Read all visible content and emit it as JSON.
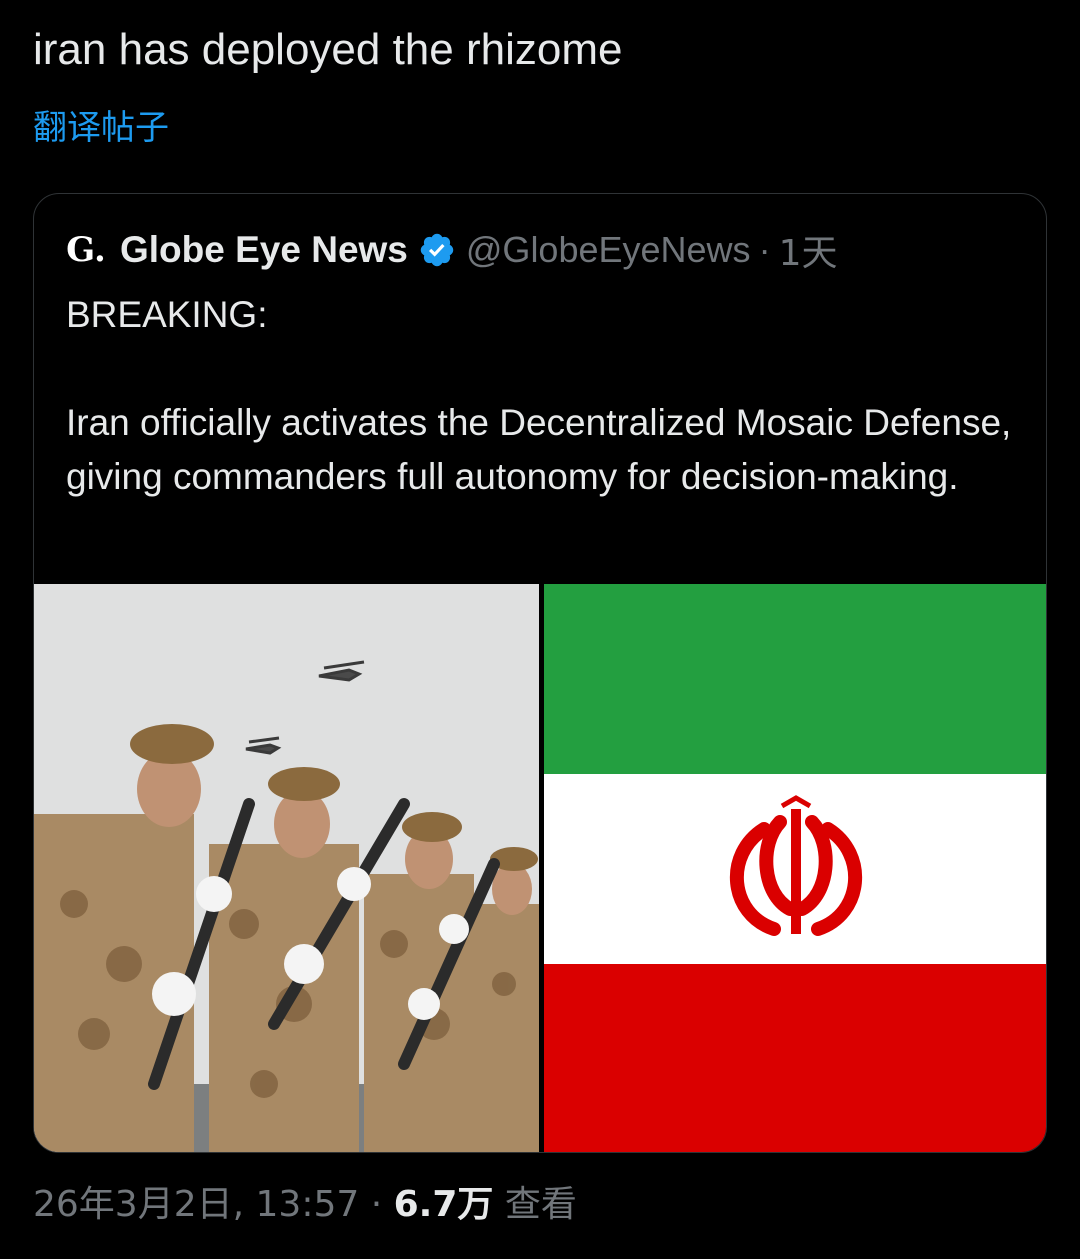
{
  "tweet": {
    "text": "iran has deployed the rhizome",
    "translate_label": "翻译帖子"
  },
  "quoted": {
    "avatar_letter": "G.",
    "display_name": "Globe Eye News",
    "handle": "@GlobeEyeNews",
    "separator": "·",
    "time": "1天",
    "lines": [
      "BREAKING:",
      "Iran officially activates the Decentralized Mosaic Defense, giving commanders full autonomy for decision-making."
    ],
    "verified_color": "#1d9bf0",
    "media": [
      {
        "kind": "photo",
        "icon": "soldiers-photo"
      },
      {
        "kind": "photo",
        "icon": "iran-flag"
      }
    ],
    "flag_colors": {
      "green": "#239f40",
      "white": "#ffffff",
      "red": "#da0000"
    }
  },
  "footer": {
    "timestamp": "26年3月2日, 13:57",
    "separator": "·",
    "views": "6.7万",
    "views_label": "查看"
  }
}
